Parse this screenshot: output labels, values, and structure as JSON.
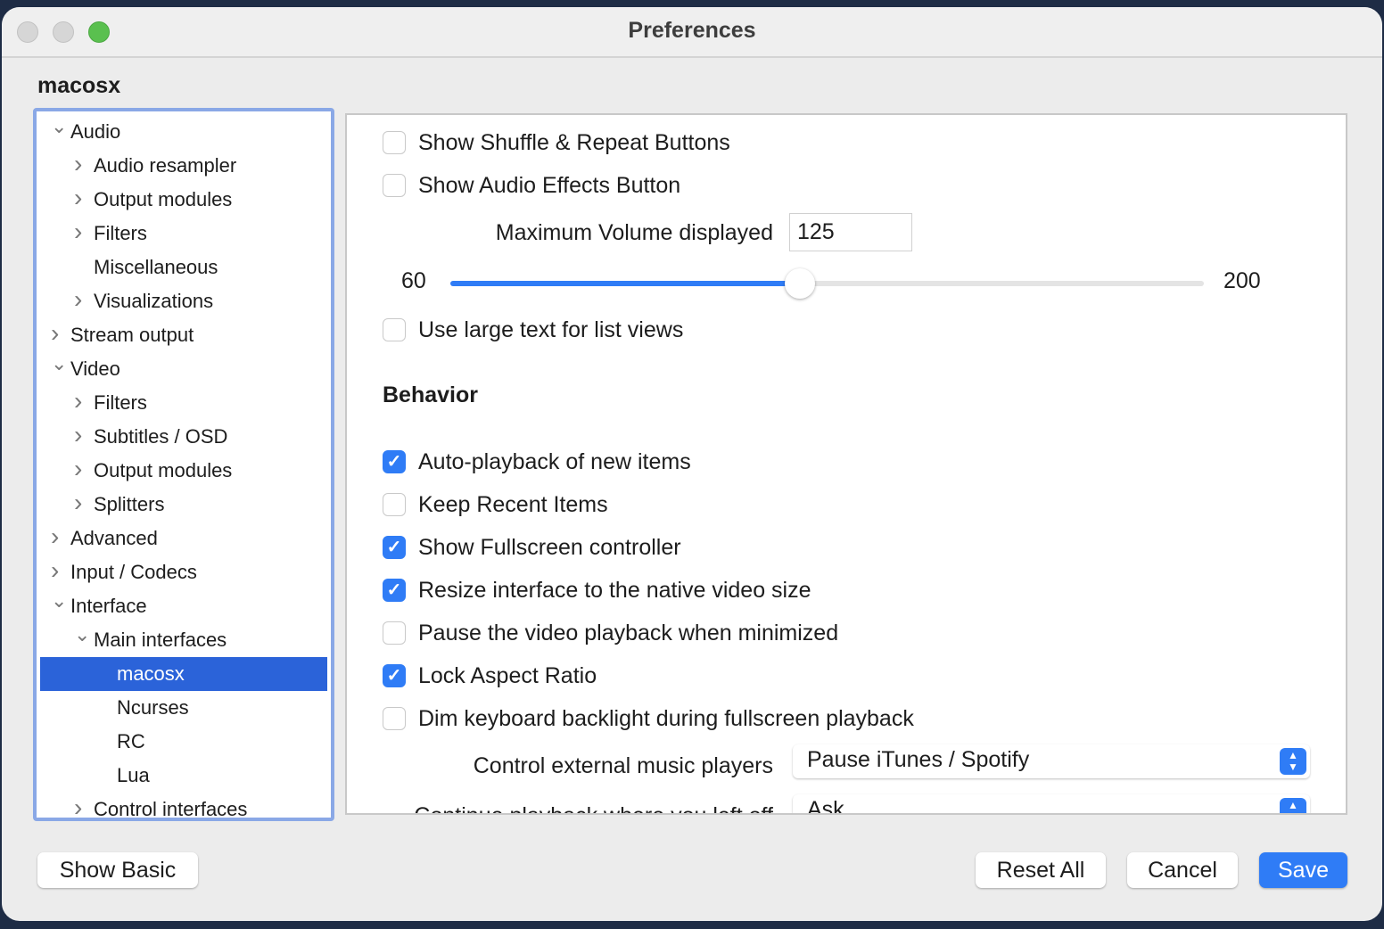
{
  "window": {
    "title": "Preferences",
    "section_heading": "macosx"
  },
  "tree": [
    {
      "label": "Audio",
      "level": 0,
      "chevron": "down"
    },
    {
      "label": "Audio resampler",
      "level": 1,
      "chevron": "right"
    },
    {
      "label": "Output modules",
      "level": 1,
      "chevron": "right"
    },
    {
      "label": "Filters",
      "level": 1,
      "chevron": "right"
    },
    {
      "label": "Miscellaneous",
      "level": 1,
      "chevron": ""
    },
    {
      "label": "Visualizations",
      "level": 1,
      "chevron": "right"
    },
    {
      "label": "Stream output",
      "level": 0,
      "chevron": "right"
    },
    {
      "label": "Video",
      "level": 0,
      "chevron": "down"
    },
    {
      "label": "Filters",
      "level": 1,
      "chevron": "right"
    },
    {
      "label": "Subtitles / OSD",
      "level": 1,
      "chevron": "right"
    },
    {
      "label": "Output modules",
      "level": 1,
      "chevron": "right"
    },
    {
      "label": "Splitters",
      "level": 1,
      "chevron": "right"
    },
    {
      "label": "Advanced",
      "level": 0,
      "chevron": "right"
    },
    {
      "label": "Input / Codecs",
      "level": 0,
      "chevron": "right"
    },
    {
      "label": "Interface",
      "level": 0,
      "chevron": "down"
    },
    {
      "label": "Main interfaces",
      "level": 1,
      "chevron": "down"
    },
    {
      "label": "macosx",
      "level": 2,
      "chevron": "",
      "selected": true
    },
    {
      "label": "Ncurses",
      "level": 2,
      "chevron": ""
    },
    {
      "label": "RC",
      "level": 2,
      "chevron": ""
    },
    {
      "label": "Lua",
      "level": 2,
      "chevron": ""
    },
    {
      "label": "Control interfaces",
      "level": 1,
      "chevron": "right"
    }
  ],
  "settings": {
    "shuffle": {
      "label": "Show Shuffle & Repeat Buttons",
      "checked": false
    },
    "effects": {
      "label": "Show Audio Effects Button",
      "checked": false
    },
    "max_volume": {
      "label": "Maximum Volume displayed",
      "value": "125"
    },
    "slider": {
      "min": "60",
      "max": "200",
      "value": 125
    },
    "large_text": {
      "label": "Use large text for list views",
      "checked": false
    },
    "behavior_heading": "Behavior",
    "behavior": [
      {
        "label": "Auto-playback of new items",
        "checked": true
      },
      {
        "label": "Keep Recent Items",
        "checked": false
      },
      {
        "label": "Show Fullscreen controller",
        "checked": true
      },
      {
        "label": "Resize interface to the native video size",
        "checked": true
      },
      {
        "label": "Pause the video playback when minimized",
        "checked": false
      },
      {
        "label": "Lock Aspect Ratio",
        "checked": true
      },
      {
        "label": "Dim keyboard backlight during fullscreen playback",
        "checked": false
      }
    ],
    "external_players": {
      "label": "Control external music players",
      "value": "Pause iTunes / Spotify"
    },
    "continue_playback": {
      "label": "Continue playback where you left off",
      "value": "Ask"
    }
  },
  "buttons": {
    "show_basic": "Show Basic",
    "reset_all": "Reset All",
    "cancel": "Cancel",
    "save": "Save"
  },
  "colors": {
    "accent": "#2f7cf6",
    "selection": "#2b63d9",
    "focus_ring": "#8aa8e6"
  }
}
